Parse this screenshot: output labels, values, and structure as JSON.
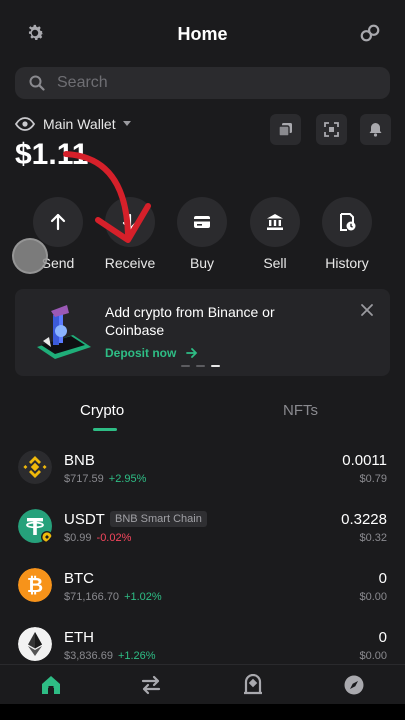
{
  "header": {
    "title": "Home"
  },
  "search": {
    "placeholder": "Search"
  },
  "wallet": {
    "name": "Main Wallet",
    "balance": "$1.11"
  },
  "actions": [
    {
      "label": "Send"
    },
    {
      "label": "Receive"
    },
    {
      "label": "Buy"
    },
    {
      "label": "Sell"
    },
    {
      "label": "History"
    }
  ],
  "banner": {
    "text": "Add crypto from Binance or Coinbase",
    "cta": "Deposit now",
    "close": "×"
  },
  "tabs": [
    {
      "label": "Crypto",
      "active": true
    },
    {
      "label": "NFTs",
      "active": false
    }
  ],
  "assets": [
    {
      "symbol": "BNB",
      "chain": "",
      "price": "$717.59",
      "change": "+2.95%",
      "amount": "0.0011",
      "value": "$0.79"
    },
    {
      "symbol": "USDT",
      "chain": "BNB Smart Chain",
      "price": "$0.99",
      "change": "-0.02%",
      "amount": "0.3228",
      "value": "$0.32"
    },
    {
      "symbol": "BTC",
      "chain": "",
      "price": "$71,166.70",
      "change": "+1.02%",
      "amount": "0",
      "value": "$0.00"
    },
    {
      "symbol": "ETH",
      "chain": "",
      "price": "$3,836.69",
      "change": "+1.26%",
      "amount": "0",
      "value": "$0.00"
    }
  ],
  "colors": {
    "positive": "#2ebd85",
    "negative": "#f6465d",
    "accent": "#2ebd85",
    "annotation_arrow": "#d6202a"
  }
}
